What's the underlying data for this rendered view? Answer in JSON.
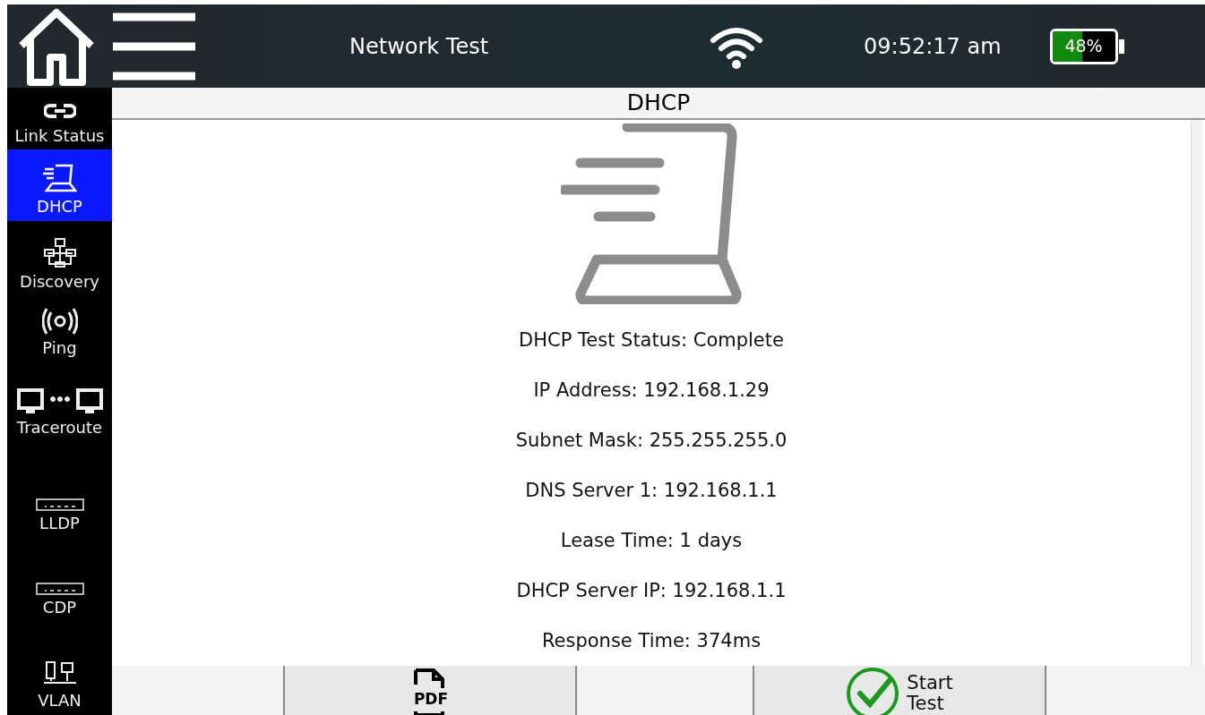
{
  "header": {
    "title": "Network Test",
    "time": "09:52:17 am",
    "battery": {
      "level": 0.48,
      "reading": "48%"
    }
  },
  "sidebar": {
    "items": [
      {
        "label": "Link Status",
        "selected": false
      },
      {
        "label": "DHCP",
        "selected": true
      },
      {
        "label": "Discovery",
        "selected": false
      },
      {
        "label": "Ping",
        "selected": false
      },
      {
        "label": "Traceroute",
        "selected": false
      },
      {
        "label": "LLDP",
        "selected": false
      },
      {
        "label": "CDP",
        "selected": false
      },
      {
        "label": "VLAN",
        "selected": false
      }
    ]
  },
  "panel": {
    "title": "DHCP",
    "lines": [
      "DHCP Test Status: Complete",
      "IP Address: 192.168.1.29",
      "Subnet Mask: 255.255.255.0",
      "DNS Server 1: 192.168.1.1",
      "Lease Time: 1 days",
      "DHCP Server IP: 192.168.1.1",
      "Response Time: 374ms"
    ]
  },
  "footer": {
    "pdf_button": {
      "label": "PDF"
    },
    "start_button": {
      "label": "Start\nTest"
    }
  }
}
